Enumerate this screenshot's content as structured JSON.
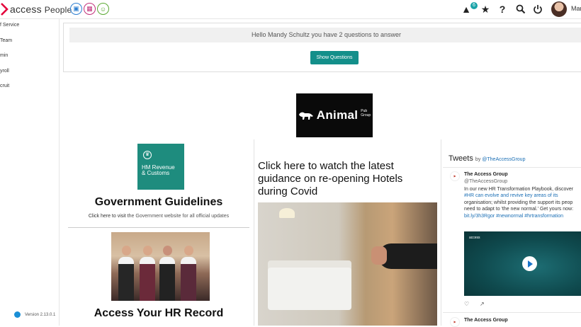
{
  "app": {
    "brand": "access",
    "product": "People",
    "notifications_count": "6",
    "user_name_partial": "Man"
  },
  "sidebar": {
    "items": [
      {
        "label": "f Service"
      },
      {
        "label": "Team"
      },
      {
        "label": "min"
      },
      {
        "label": "yroll"
      },
      {
        "label": "cruit"
      }
    ],
    "version": "Version 2.13.0.1"
  },
  "questions": {
    "banner": "Hello Mandy Schultz you have 2 questions to answer",
    "button": "Show Questions"
  },
  "banner_logo": {
    "word": "Animal",
    "sub1": "Pub",
    "sub2": "Group"
  },
  "left_column": {
    "hmrc_line1": "HM Revenue",
    "hmrc_line2": "& Customs",
    "gov_title": "Government Guidelines",
    "gov_sub_link": "Click here to visit t",
    "gov_sub_rest": "he Government website for all official updates",
    "hr_title": "Access Your HR Record"
  },
  "middle_column": {
    "watch_title": "Click here to watch the latest guidance on re-opening Hotels during Covid"
  },
  "tweets": {
    "heading": "Tweets",
    "by_prefix": "by",
    "by_handle": "@TheAccessGroup",
    "tweet1": {
      "name": "The Access Group",
      "handle": "@TheAccessGroup",
      "lines": [
        "In our new HR Transformation Playbook, discover",
        "#HR can evolve and revive key areas of its",
        "organisation; whilst providing the support its peop",
        "need to adapt to 'the new normal.' Get yours now:",
        "bit.ly/3h3Rgor #newnormal #hrtransformation"
      ],
      "media_logo": "access"
    },
    "tweet2": {
      "name": "The Access Group"
    }
  },
  "colors": {
    "teal": "#138f8a",
    "hmrc_green": "#1e8c7e",
    "link": "#1b6fb5",
    "brand_red": "#e4003b"
  }
}
